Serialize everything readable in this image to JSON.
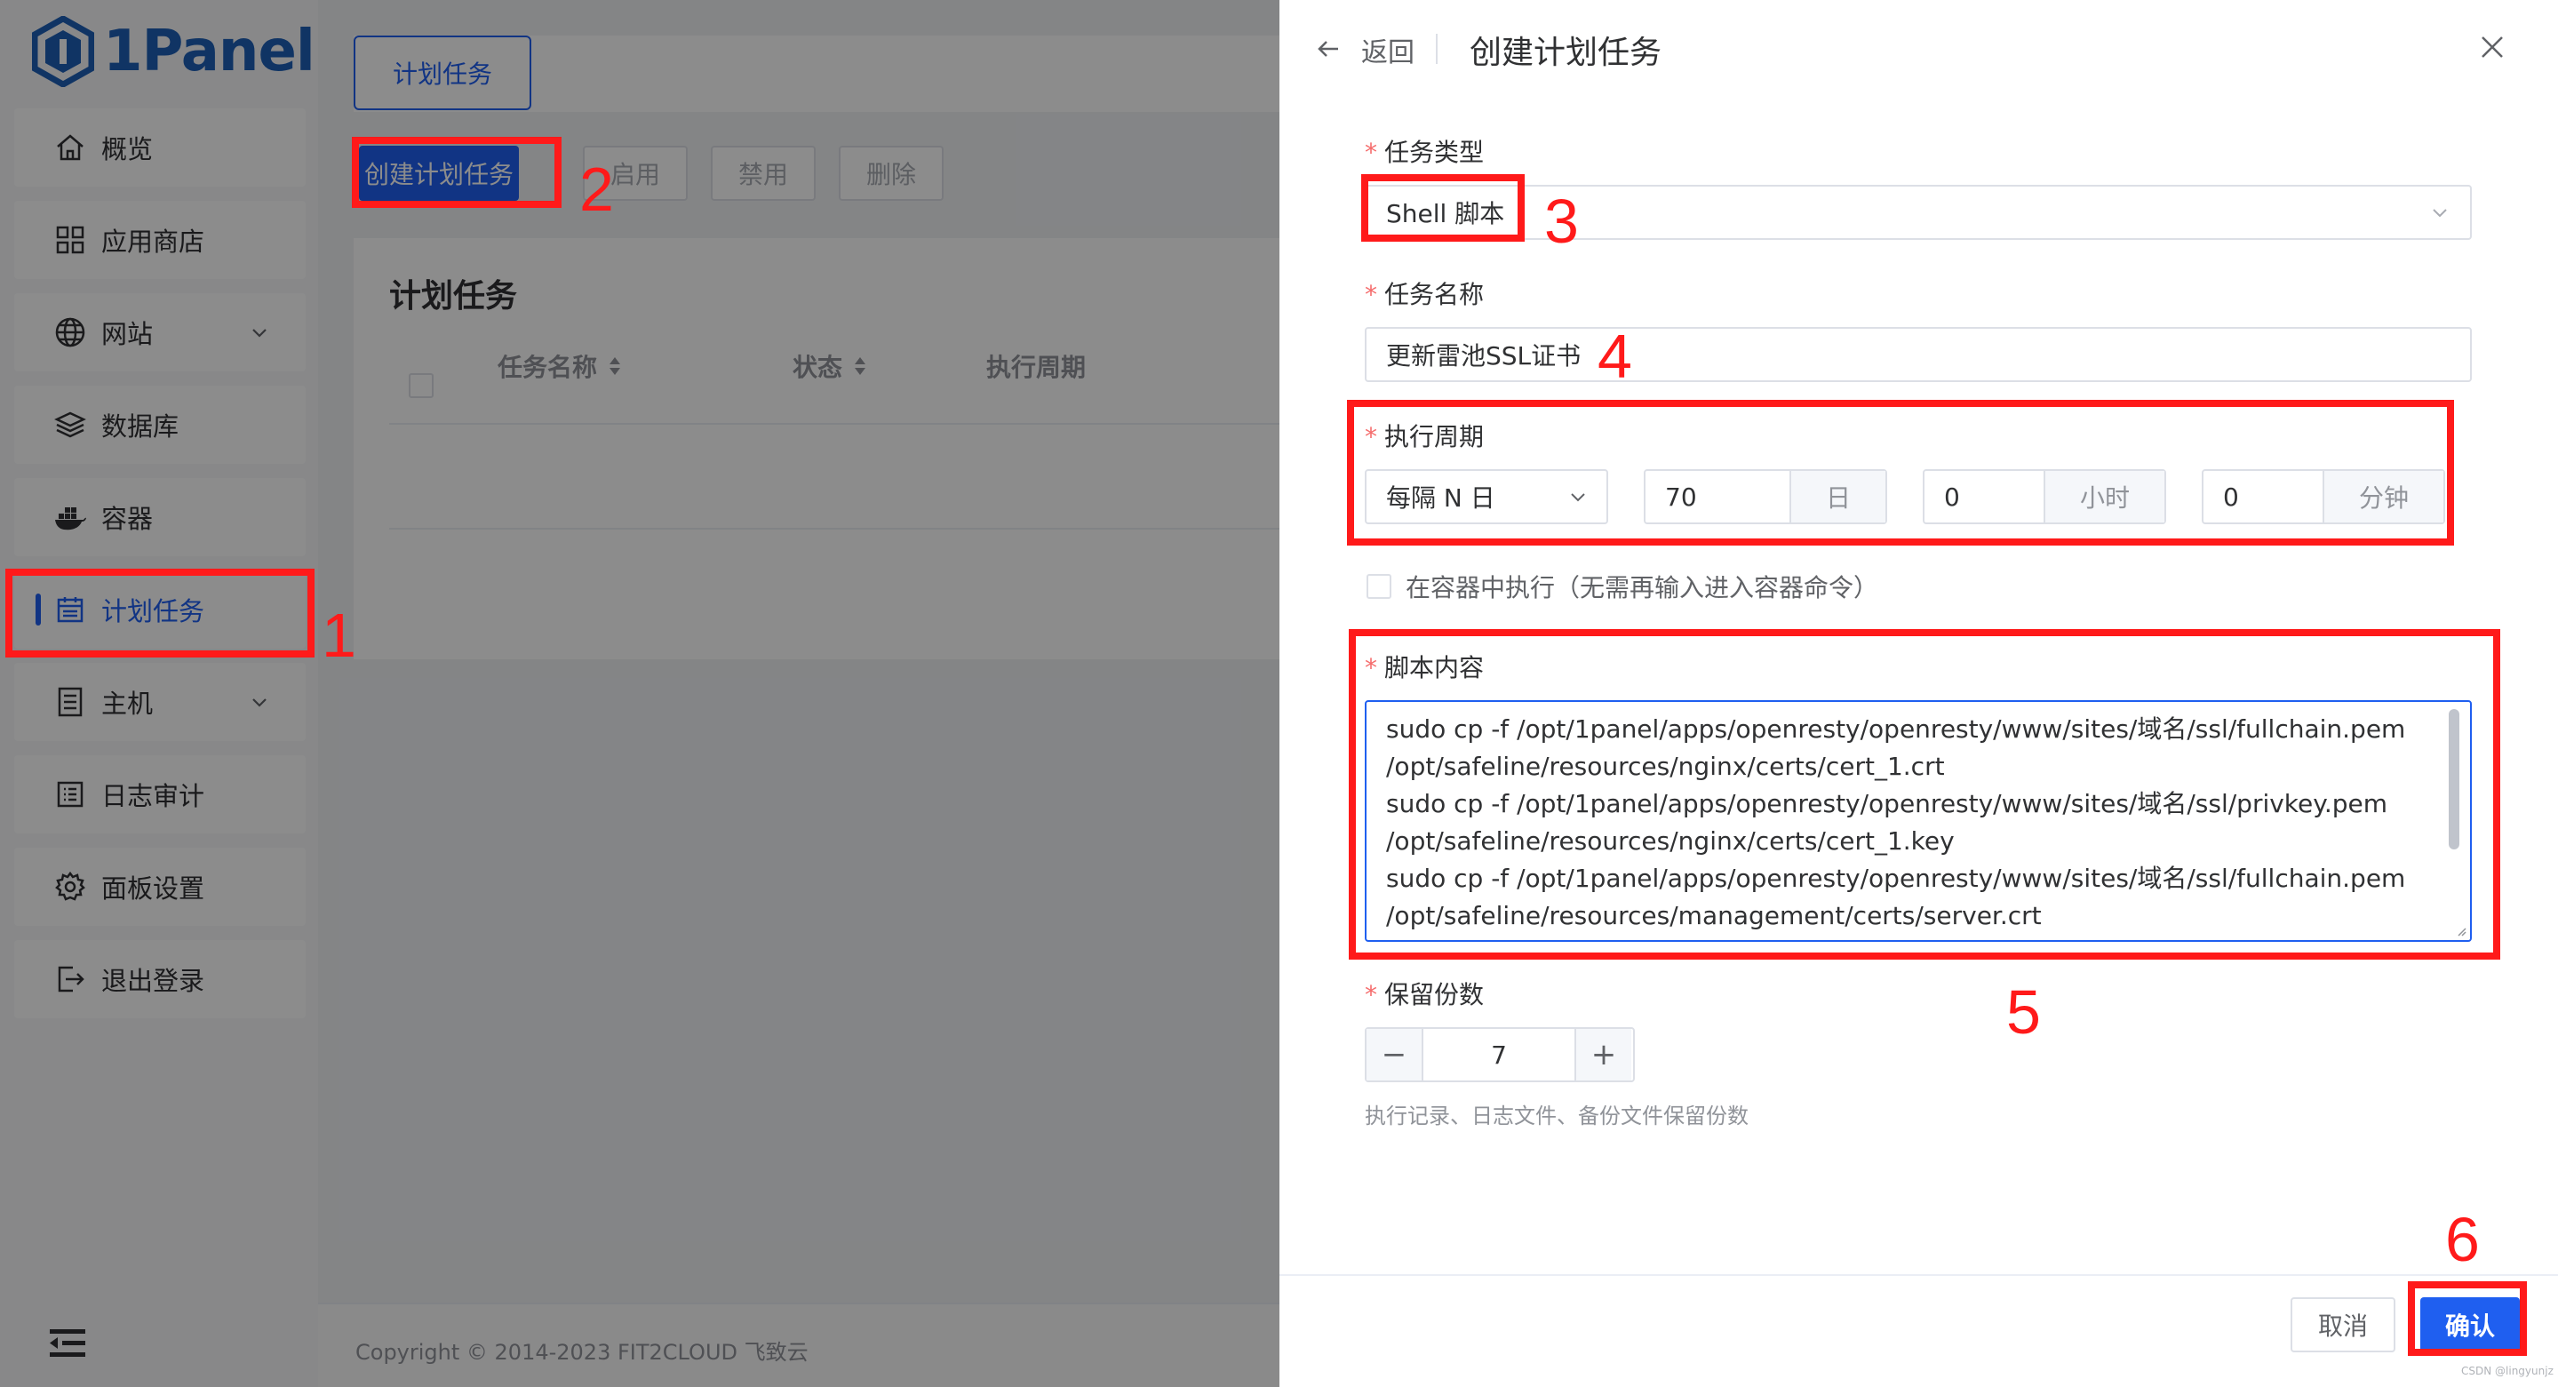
{
  "app": {
    "name": "1Panel"
  },
  "sidebar": {
    "items": [
      {
        "label": "概览",
        "icon": "home-icon"
      },
      {
        "label": "应用商店",
        "icon": "grid-icon"
      },
      {
        "label": "网站",
        "icon": "globe-icon",
        "expandable": true
      },
      {
        "label": "数据库",
        "icon": "layers-icon"
      },
      {
        "label": "容器",
        "icon": "docker-icon"
      },
      {
        "label": "计划任务",
        "icon": "calendar-icon",
        "active": true
      },
      {
        "label": "主机",
        "icon": "host-icon",
        "expandable": true
      },
      {
        "label": "日志审计",
        "icon": "log-icon"
      },
      {
        "label": "面板设置",
        "icon": "gear-icon"
      },
      {
        "label": "退出登录",
        "icon": "logout-icon"
      }
    ]
  },
  "main": {
    "tab": "计划任务",
    "toolbar": {
      "create": "创建计划任务",
      "enable": "启用",
      "disable": "禁用",
      "delete": "删除"
    },
    "card_title": "计划任务",
    "columns": [
      "任务名称",
      "状态",
      "执行周期"
    ],
    "copyright": "Copyright © 2014-2023 FIT2CLOUD 飞致云"
  },
  "drawer": {
    "back": "返回",
    "title": "创建计划任务",
    "task_type": {
      "label": "任务类型",
      "value": "Shell 脚本"
    },
    "task_name": {
      "label": "任务名称",
      "value": "更新雷池SSL证书"
    },
    "cycle": {
      "label": "执行周期",
      "mode": "每隔 N 日",
      "day_value": "70",
      "day_unit": "日",
      "hour_value": "0",
      "hour_unit": "小时",
      "minute_value": "0",
      "minute_unit": "分钟"
    },
    "container_exec": {
      "label": "在容器中执行（无需再输入进入容器命令）",
      "checked": false
    },
    "script": {
      "label": "脚本内容",
      "lines": [
        "sudo cp -f /opt/1panel/apps/openresty/openresty/www/sites/域名/ssl/fullchain.pem",
        "/opt/safeline/resources/nginx/certs/cert_1.crt",
        "sudo cp -f /opt/1panel/apps/openresty/openresty/www/sites/域名/ssl/privkey.pem",
        "/opt/safeline/resources/nginx/certs/cert_1.key",
        "sudo cp -f /opt/1panel/apps/openresty/openresty/www/sites/域名/ssl/fullchain.pem",
        "/opt/safeline/resources/management/certs/server.crt"
      ]
    },
    "retain": {
      "label": "保留份数",
      "value": "7",
      "minus": "−",
      "plus": "+",
      "hint": "执行记录、日志文件、备份文件保留份数"
    },
    "cancel": "取消",
    "confirm": "确认",
    "watermark": "CSDN @lingyunjz"
  },
  "annotations": [
    "1",
    "2",
    "3",
    "4",
    "5",
    "6"
  ],
  "colors": {
    "primary": "#1f5ff0",
    "annotation": "#ff1a1a",
    "required": "#f56c6c"
  }
}
